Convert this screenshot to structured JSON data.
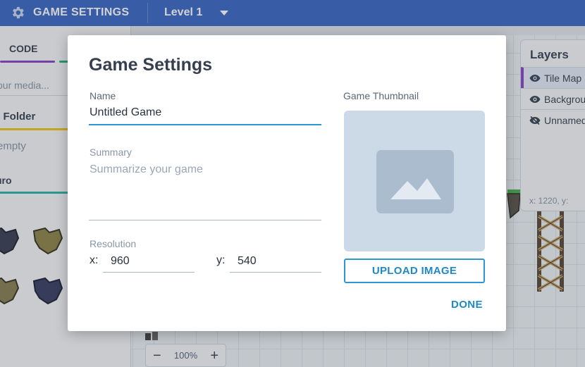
{
  "topbar": {
    "title": "GAME SETTINGS",
    "level": "Level 1",
    "icons": {
      "gear": "gear-icon",
      "level_dropdown": "chevron-down-icon"
    }
  },
  "left_panel": {
    "tab_code": "CODE",
    "search_placeholder": "our media...",
    "folder_label": "e Folder",
    "folder_empty": "empty",
    "section_label": "uro"
  },
  "zoom": {
    "minus": "−",
    "value": "100%",
    "plus": "+"
  },
  "layers": {
    "title": "Layers",
    "items": [
      {
        "label": "Tile Map",
        "icon": "eye-icon",
        "active": true
      },
      {
        "label": "Backgrou",
        "icon": "eye-icon",
        "active": false
      },
      {
        "label": "Unnamed",
        "icon": "eye-off-icon",
        "active": false
      }
    ],
    "coords": "x: 1220, y:"
  },
  "modal": {
    "title": "Game Settings",
    "name": {
      "label": "Name",
      "value": "Untitled Game"
    },
    "summary": {
      "label": "Summary",
      "placeholder": "Summarize your game",
      "value": ""
    },
    "resolution": {
      "label": "Resolution",
      "x_label": "x:",
      "x_value": "960",
      "y_label": "y:",
      "y_value": "540"
    },
    "thumbnail": {
      "label": "Game Thumbnail",
      "icon": "image-placeholder-icon"
    },
    "upload_button": "UPLOAD IMAGE",
    "done_button": "DONE"
  },
  "colors": {
    "topbar": "#3d68c3",
    "accent": "#2d97d6",
    "code_tab": "#8b44c6",
    "folder": "#f0c419"
  }
}
